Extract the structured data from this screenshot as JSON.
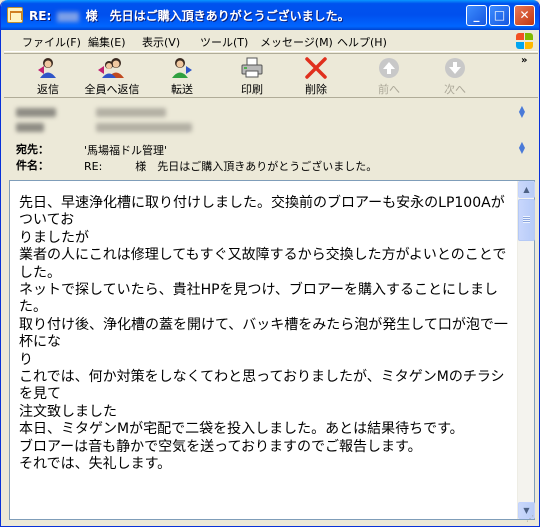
{
  "window": {
    "title_prefix": "RE:",
    "title_suffix": "様　先日はご購入頂きありがとうございました。",
    "controls": {
      "minimize": "_",
      "maximize": "□",
      "close": "✕"
    }
  },
  "menu": {
    "items": [
      {
        "label": "ファイル(F)"
      },
      {
        "label": "編集(E)"
      },
      {
        "label": "表示(V)"
      },
      {
        "label": "ツール(T)"
      },
      {
        "label": "メッセージ(M)"
      },
      {
        "label": "ヘルプ(H)"
      }
    ]
  },
  "toolbar": {
    "reply": "返信",
    "reply_all": "全員へ返信",
    "forward": "転送",
    "print": "印刷",
    "delete": "削除",
    "previous": "前へ",
    "next": "次へ",
    "more": "»"
  },
  "header": {
    "to_label": "宛先：",
    "to_value": "'馬場福ドル管理'",
    "subject_label": "件名：",
    "subject_value": "RE:　　　様　先日はご購入頂きありがとうございました。"
  },
  "message": {
    "body": "先日、早速浄化槽に取り付けしました。交換前のブロアーも安永のLP100Aがついてお\nりましたが\n業者の人にこれは修理してもすぐ又故障するから交換した方がよいとのことでした。\nネットで探していたら、貴社HPを見つけ、ブロアーを購入することにしました。\n取り付け後、浄化槽の蓋を開けて、バッキ槽をみたら泡が発生して口が泡で一杯にな\nり\nこれでは、何か対策をしなくてわと思っておりましたが、ミタゲンMのチラシを見て\n注文致しました\n本日、ミタゲンMが宅配で二袋を投入しました。あとは結果待ちです。\nブロアーは音も静かで空気を送っておりますのでご報告します。\nそれでは、失礼します。"
  },
  "colors": {
    "titlebar": "#0054E3",
    "window_bg": "#ECE9D8",
    "delete_red": "#E0301E",
    "disabled_gray": "#ACA899"
  }
}
